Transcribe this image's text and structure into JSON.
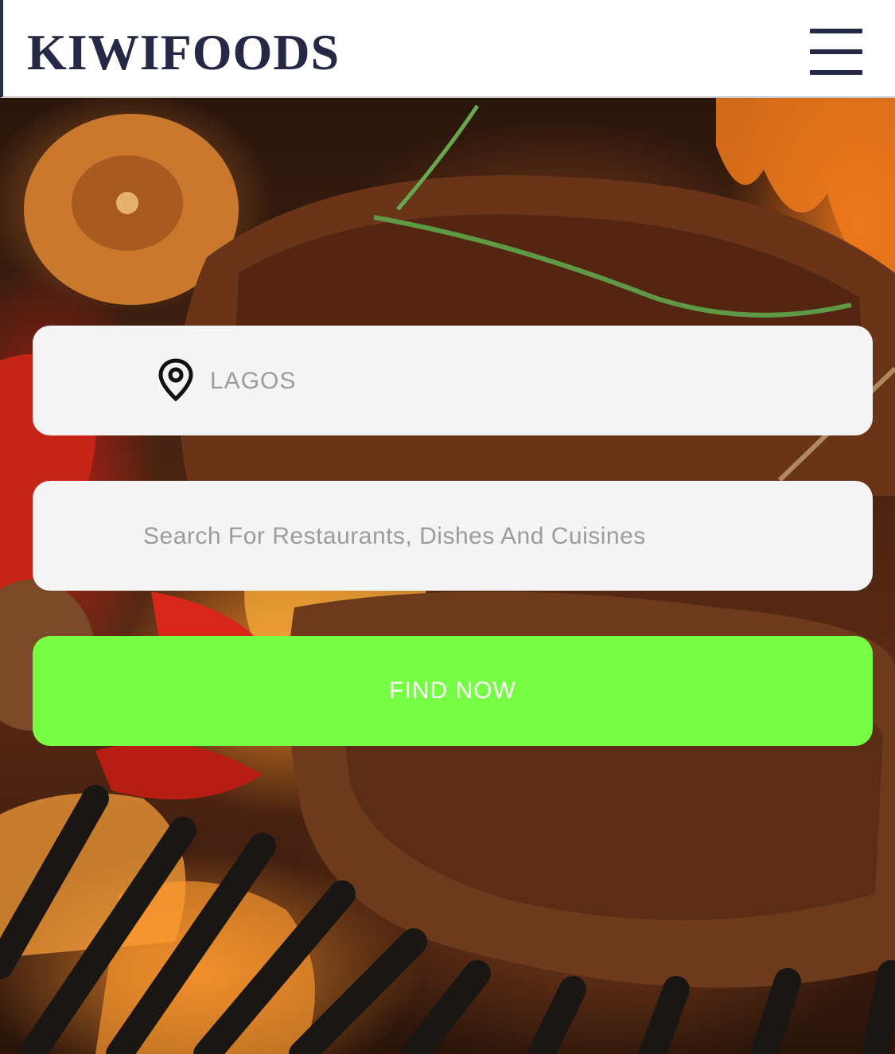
{
  "header": {
    "logo": "KIWIFOODS",
    "menu_icon": "hamburger-menu-icon"
  },
  "hero": {
    "background": "grilled-steak-photo"
  },
  "form": {
    "location": {
      "icon": "map-pin-icon",
      "placeholder": "LAGOS"
    },
    "search": {
      "placeholder": "Search For Restaurants, Dishes And Cuisines"
    },
    "submit_label": "FIND NOW"
  },
  "colors": {
    "brand": "#252945",
    "button": "#77fc46",
    "field_bg": "#f4f4f4",
    "placeholder": "#9c9c9c"
  }
}
